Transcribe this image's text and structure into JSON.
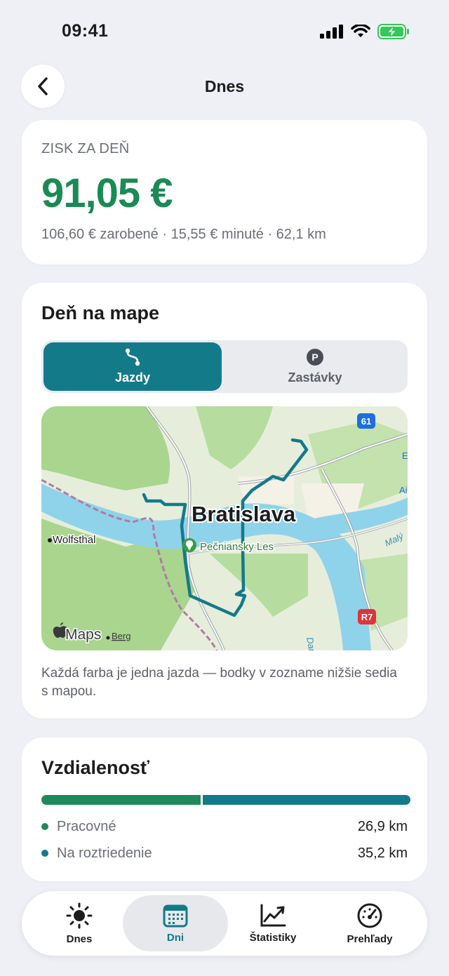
{
  "status_bar": {
    "time": "09:41"
  },
  "nav": {
    "title": "Dnes"
  },
  "profit_card": {
    "label": "ZISK ZA DEŇ",
    "value": "91,05 €",
    "summary": "106,60 € zarobené · 15,55 € minuté · 62,1 km"
  },
  "map_card": {
    "title": "Deň na mape",
    "segments": [
      {
        "label": "Jazdy",
        "icon": "route-icon",
        "selected": true
      },
      {
        "label": "Zastávky",
        "icon": "parking-icon",
        "selected": false
      }
    ],
    "map_labels": {
      "city": "Bratislava",
      "park": "Pečniansky Les",
      "town": "Wolfsthal",
      "attribution": "Maps",
      "legal": "Berg",
      "road_61": "61",
      "road_r7": "R7",
      "river_right": "Malý",
      "river_bottom": "Dar",
      "edge_1": "E",
      "edge_2": "Ai"
    },
    "route_color": "#137a8a",
    "caption": "Každá farba je jedna jazda — bodky v zozname nižšie sedia s mapou."
  },
  "distance_card": {
    "title": "Vzdialenosť",
    "rows": [
      {
        "label": "Pracovné",
        "value": "26,9 km",
        "km": 26.9,
        "color": "#1e8a5a"
      },
      {
        "label": "Na roztriedenie",
        "value": "35,2 km",
        "km": 35.2,
        "color": "#137a8a"
      }
    ]
  },
  "tab_bar": {
    "tabs": [
      {
        "label": "Dnes",
        "icon": "sun-icon",
        "active": false
      },
      {
        "label": "Dni",
        "icon": "calendar-icon",
        "active": true
      },
      {
        "label": "Štatistiky",
        "icon": "chart-icon",
        "active": false
      },
      {
        "label": "Prehľady",
        "icon": "gauge-icon",
        "active": false
      }
    ]
  },
  "colors": {
    "accent": "#137a8a",
    "profit": "#1b8a55",
    "background": "#eef0f5"
  }
}
